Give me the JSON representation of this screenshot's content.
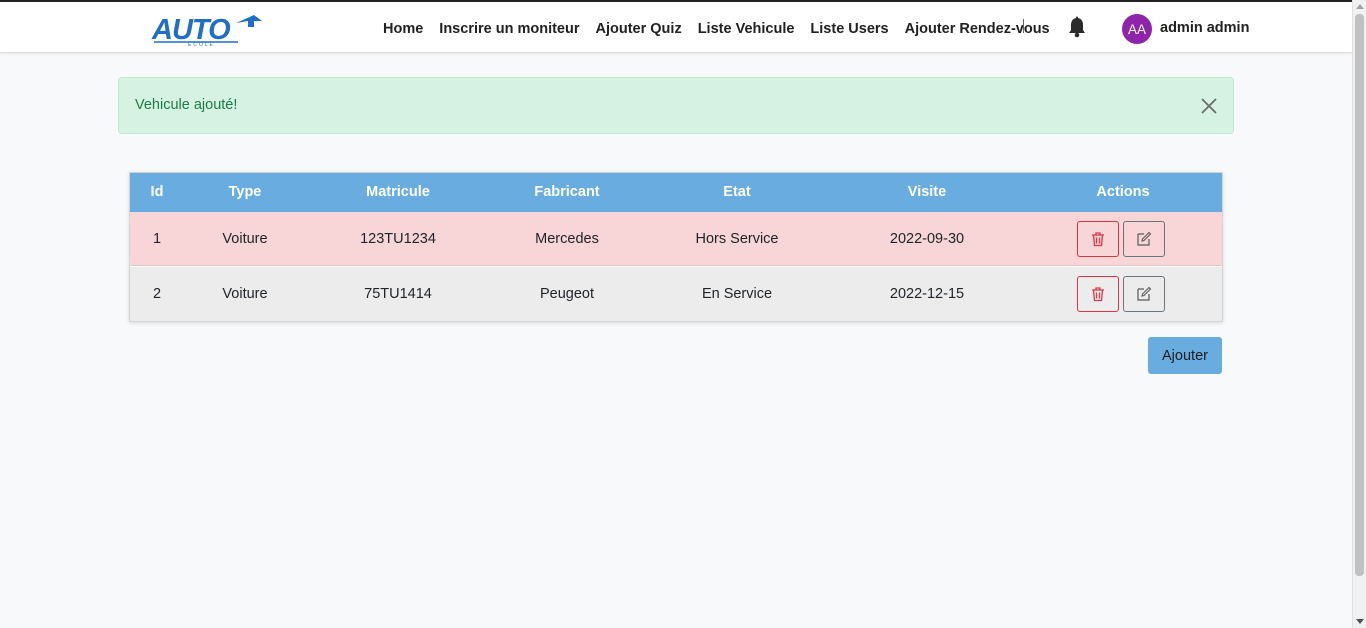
{
  "brand": {
    "logo_text": "AUTO",
    "logo_subtext": "ECOLE",
    "logo_color": "#1f6fc9"
  },
  "nav": {
    "items": [
      {
        "label": "Home"
      },
      {
        "label": "Inscrire un moniteur"
      },
      {
        "label": "Ajouter Quiz"
      },
      {
        "label": "Liste Vehicule"
      },
      {
        "label": "Liste Users"
      },
      {
        "label": "Ajouter Rendez-vous"
      }
    ],
    "notification_icon": "bell-icon",
    "user": {
      "initials": "AA",
      "name": "admin admin",
      "avatar_color": "#8e24aa"
    }
  },
  "alert": {
    "message": "Vehicule ajouté!",
    "close_icon": "close-icon",
    "color": "#1c7c47",
    "background": "#d5f2e3"
  },
  "table": {
    "header_color": "#68ace0",
    "columns": [
      "Id",
      "Type",
      "Matricule",
      "Fabricant",
      "Etat",
      "Visite",
      "Actions"
    ],
    "rows": [
      {
        "id": "1",
        "type": "Voiture",
        "matricule": "123TU1234",
        "fabricant": "Mercedes",
        "etat": "Hors Service",
        "visite": "2022-09-30",
        "row_color": "#f8d5d6"
      },
      {
        "id": "2",
        "type": "Voiture",
        "matricule": "75TU1414",
        "fabricant": "Peugeot",
        "etat": "En Service",
        "visite": "2022-12-15",
        "row_color": "#ececed"
      }
    ],
    "row_actions": {
      "delete_icon": "trash-icon",
      "edit_icon": "edit-icon"
    }
  },
  "add_button": {
    "label": "Ajouter"
  }
}
